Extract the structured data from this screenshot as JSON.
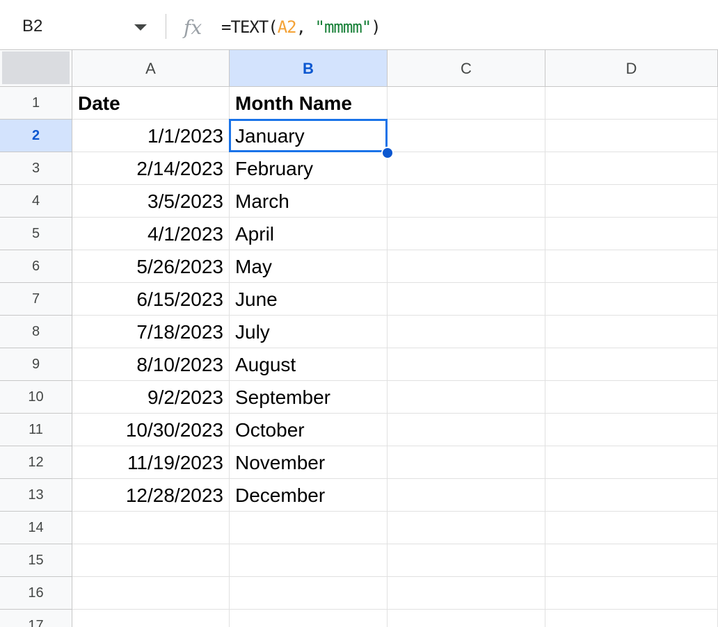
{
  "formula_bar": {
    "name_box": "B2",
    "formula_prefix": "=TEXT(",
    "formula_ref": "A2",
    "formula_sep": ", ",
    "formula_string": "\"mmmm\"",
    "formula_suffix": ")",
    "fx_icon": "function-icon"
  },
  "columns": [
    "A",
    "B",
    "C",
    "D"
  ],
  "selected_cell": "B2",
  "rows": [
    {
      "num": "1",
      "date": "Date",
      "month": "Month Name"
    },
    {
      "num": "2",
      "date": "1/1/2023",
      "month": "January"
    },
    {
      "num": "3",
      "date": "2/14/2023",
      "month": "February"
    },
    {
      "num": "4",
      "date": "3/5/2023",
      "month": "March"
    },
    {
      "num": "5",
      "date": "4/1/2023",
      "month": "April"
    },
    {
      "num": "6",
      "date": "5/26/2023",
      "month": "May"
    },
    {
      "num": "7",
      "date": "6/15/2023",
      "month": "June"
    },
    {
      "num": "8",
      "date": "7/18/2023",
      "month": "July"
    },
    {
      "num": "9",
      "date": "8/10/2023",
      "month": "August"
    },
    {
      "num": "10",
      "date": "9/2/2023",
      "month": "September"
    },
    {
      "num": "11",
      "date": "10/30/2023",
      "month": "October"
    },
    {
      "num": "12",
      "date": "11/19/2023",
      "month": "November"
    },
    {
      "num": "13",
      "date": "12/28/2023",
      "month": "December"
    },
    {
      "num": "14",
      "date": "",
      "month": ""
    },
    {
      "num": "15",
      "date": "",
      "month": ""
    },
    {
      "num": "16",
      "date": "",
      "month": ""
    },
    {
      "num": "17",
      "date": "",
      "month": ""
    }
  ],
  "colors": {
    "selection": "#1a73e8",
    "header_selected_bg": "#d3e3fd",
    "header_selected_text": "#0b57d0",
    "formula_ref": "#f4a236",
    "formula_string": "#188038"
  }
}
